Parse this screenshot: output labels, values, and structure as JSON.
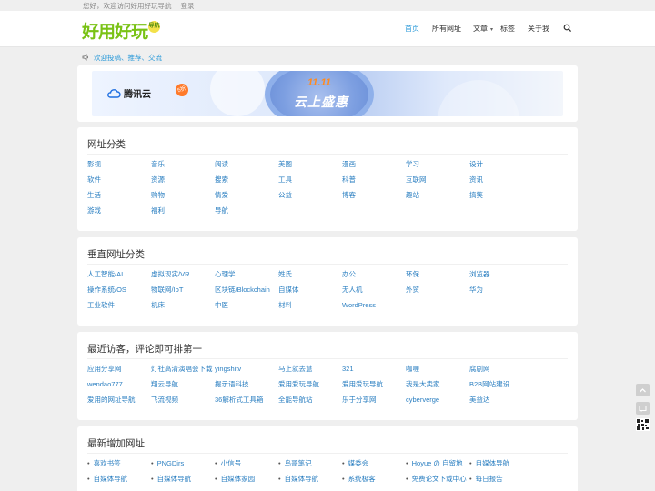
{
  "topbar": {
    "welcome": "您好，欢迎访问好用好玩导航",
    "login": "登录"
  },
  "logo": {
    "text": "好用好玩",
    "badge": "导航"
  },
  "nav": {
    "items": [
      {
        "label": "首页",
        "active": true
      },
      {
        "label": "所有网址"
      },
      {
        "label": "文章",
        "has_dropdown": true
      },
      {
        "label": "标签"
      },
      {
        "label": "关于我"
      }
    ],
    "search_icon": "search-icon"
  },
  "notice": {
    "icon": "speaker-icon",
    "text": "欢迎投稿、推荐、交流"
  },
  "banner": {
    "brand": "腾讯云",
    "badge": "5折",
    "headline_top": "11.11",
    "headline": "云上盛惠"
  },
  "sections": {
    "categories": {
      "title": "网址分类",
      "items": [
        "影视",
        "音乐",
        "阅读",
        "美图",
        "漫画",
        "学习",
        "设计",
        "软件",
        "资源",
        "搜索",
        "工具",
        "科普",
        "互联网",
        "资讯",
        "生活",
        "购物",
        "情爱",
        "公益",
        "博客",
        "趣站",
        "搞笑",
        "游戏",
        "福利",
        "导航"
      ]
    },
    "vertical": {
      "title": "垂直网址分类",
      "items": [
        "人工智能/AI",
        "虚拟现实/VR",
        "心理学",
        "姓氏",
        "办公",
        "环保",
        "浏览器",
        "操作系统/OS",
        "物联网/IoT",
        "区块链/Blockchain",
        "自媒体",
        "无人机",
        "外贸",
        "华为",
        "工业软件",
        "机床",
        "中医",
        "材料",
        "WordPress"
      ]
    },
    "visitors": {
      "title": "最近访客，评论即可排第一",
      "items": [
        "应用分享网",
        "灯社高清演唱会下载",
        "yingshitv",
        "马上就去慧",
        "321",
        "咖喱",
        "腐剧网",
        "wendao777",
        "翔云导航",
        "提示语科技",
        "爱用爱玩导航",
        "爱用爱玩导航",
        "我是大卖家",
        "B2B网站建设",
        "爱用的网址导航",
        "飞流视频",
        "36解析式工具箱",
        "全能导航站",
        "乐于分享网",
        "cyberverge",
        "美益达"
      ]
    },
    "newest": {
      "title": "最新增加网址",
      "items": [
        "喜欢书签",
        "PNGDirs",
        "小信号",
        "鸟哥笔记",
        "媒委会",
        "Hoyue の 自留地",
        "自媒体导航",
        "自媒体导航",
        "自媒体导航",
        "自媒体家园",
        "自媒体导航",
        "系统极客",
        "免费论文下载中心",
        "每日报告"
      ]
    }
  },
  "side_tools": {
    "top_icon": "chevron-up-icon",
    "message_icon": "message-icon",
    "qr_icon": "qr-code-icon"
  },
  "colors": {
    "accent": "#2b9ad9",
    "link": "#2b7fc1",
    "logo_green": "#79c215",
    "background": "#efefef"
  }
}
